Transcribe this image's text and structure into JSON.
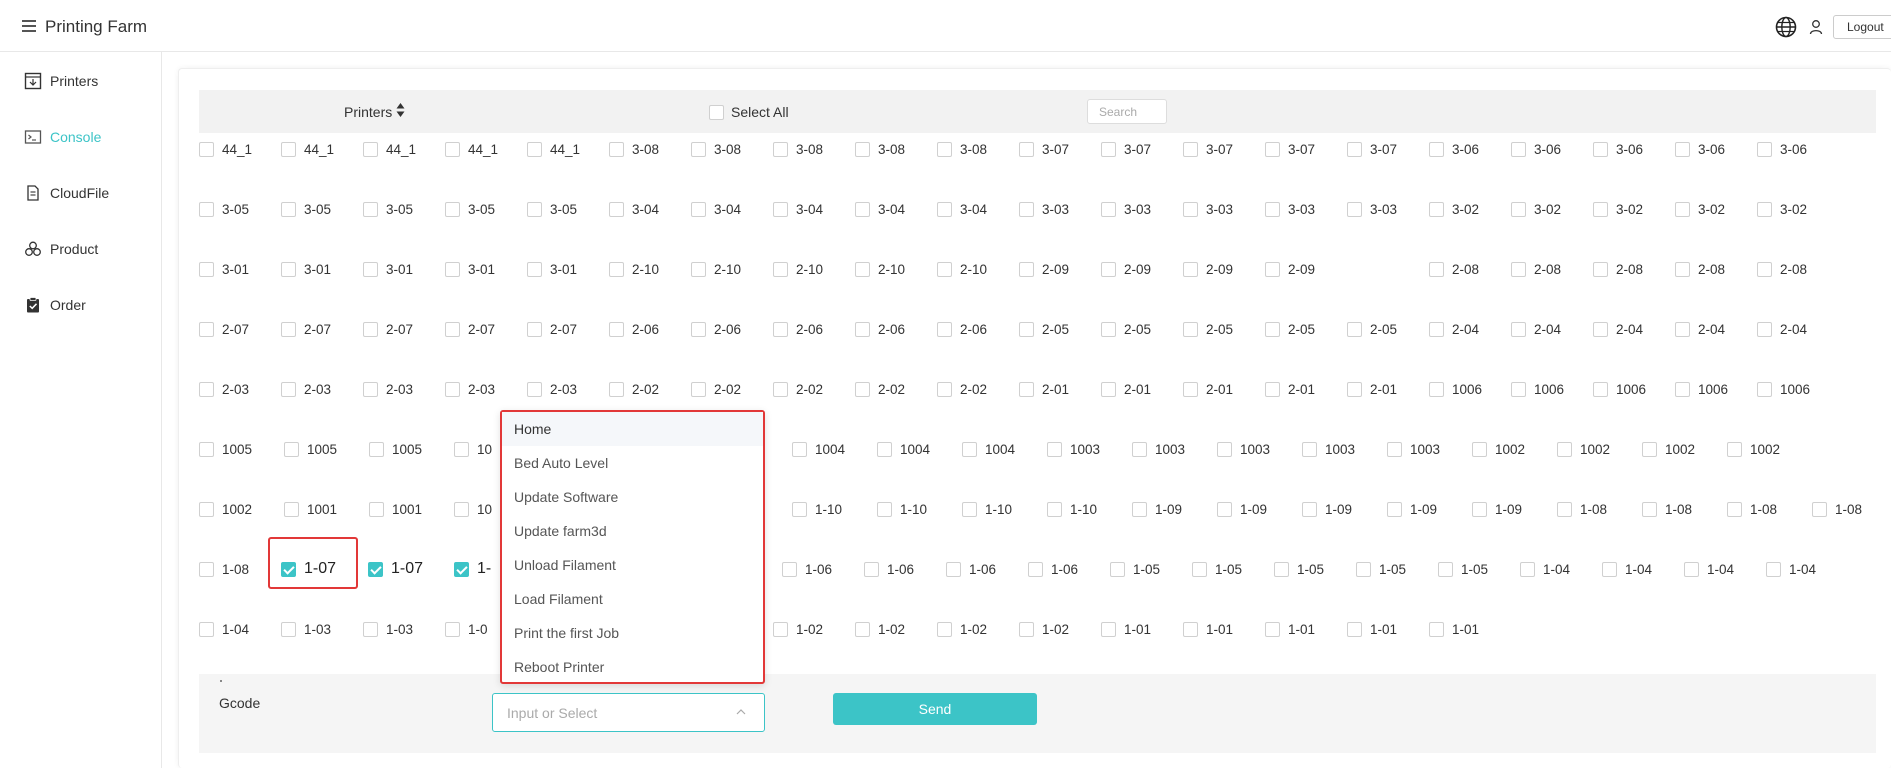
{
  "app": {
    "title": "Printing Farm",
    "logout_label": "Logout"
  },
  "sidebar": {
    "items": [
      {
        "label": "Printers",
        "icon": "monitor-icon",
        "active": false
      },
      {
        "label": "Console",
        "icon": "terminal-icon",
        "active": true
      },
      {
        "label": "CloudFile",
        "icon": "cloud-icon",
        "active": false
      },
      {
        "label": "Product",
        "icon": "product-icon",
        "active": false
      },
      {
        "label": "Order",
        "icon": "clipboard-check-icon",
        "active": false
      }
    ]
  },
  "toolbar": {
    "printers_label": "Printers",
    "select_all_label": "Select All",
    "search_placeholder": "Search"
  },
  "colors": {
    "accent": "#3cc4c7",
    "highlight": "#e23838"
  },
  "printer_rows": [
    [
      "44_1",
      "44_1",
      "44_1",
      "44_1",
      "44_1",
      "3-08",
      "3-08",
      "3-08",
      "3-08",
      "3-08",
      "3-07",
      "3-07",
      "3-07",
      "3-07",
      "3-07",
      "3-06",
      "3-06",
      "3-06",
      "3-06",
      "3-06"
    ],
    [
      "3-05",
      "3-05",
      "3-05",
      "3-05",
      "3-05",
      "3-04",
      "3-04",
      "3-04",
      "3-04",
      "3-04",
      "3-03",
      "3-03",
      "3-03",
      "3-03",
      "3-03",
      "3-02",
      "3-02",
      "3-02",
      "3-02",
      "3-02"
    ],
    [
      "3-01",
      "3-01",
      "3-01",
      "3-01",
      "3-01",
      "2-10",
      "2-10",
      "2-10",
      "2-10",
      "2-10",
      "2-09",
      "2-09",
      "2-09",
      "2-09",
      "2-08",
      "2-08",
      "2-08",
      "2-08",
      "2-08"
    ],
    [
      "2-07",
      "2-07",
      "2-07",
      "2-07",
      "2-07",
      "2-06",
      "2-06",
      "2-06",
      "2-06",
      "2-06",
      "2-05",
      "2-05",
      "2-05",
      "2-05",
      "2-05",
      "2-04",
      "2-04",
      "2-04",
      "2-04",
      "2-04"
    ],
    [
      "2-03",
      "2-03",
      "2-03",
      "2-03",
      "2-03",
      "2-02",
      "2-02",
      "2-02",
      "2-02",
      "2-02",
      "2-01",
      "2-01",
      "2-01",
      "2-01",
      "2-01",
      "1006",
      "1006",
      "1006",
      "1006",
      "1006"
    ],
    [
      "1005",
      "1005",
      "1005",
      "10",
      "1004",
      "1004",
      "1004",
      "1003",
      "1003",
      "1003",
      "1003",
      "1003",
      "1002",
      "1002",
      "1002",
      "1002"
    ],
    [
      "1002",
      "1001",
      "1001",
      "10",
      "1-10",
      "1-10",
      "1-10",
      "1-10",
      "1-09",
      "1-09",
      "1-09",
      "1-09",
      "1-09",
      "1-08",
      "1-08",
      "1-08",
      "1-08"
    ],
    [
      "1-08",
      "1-07",
      "1-07",
      "1-",
      "1-06",
      "1-06",
      "1-06",
      "1-06",
      "1-05",
      "1-05",
      "1-05",
      "1-05",
      "1-05",
      "1-04",
      "1-04",
      "1-04",
      "1-04"
    ],
    [
      "1-04",
      "1-03",
      "1-03",
      "1-0",
      "1-02",
      "1-02",
      "1-02",
      "1-02",
      "1-01",
      "1-01",
      "1-01",
      "1-01",
      "1-01"
    ]
  ],
  "checked_cells": [
    "7-1",
    "7-2",
    "7-3"
  ],
  "dropdown": {
    "items": [
      "Home",
      "Bed Auto Level",
      "Update Software",
      "Update farm3d",
      "Unload Filament",
      "Load Filament",
      "Print the first Job",
      "Reboot Printer"
    ]
  },
  "gcode": {
    "label": "Gcode",
    "placeholder": "Input or Select",
    "send_label": "Send"
  }
}
